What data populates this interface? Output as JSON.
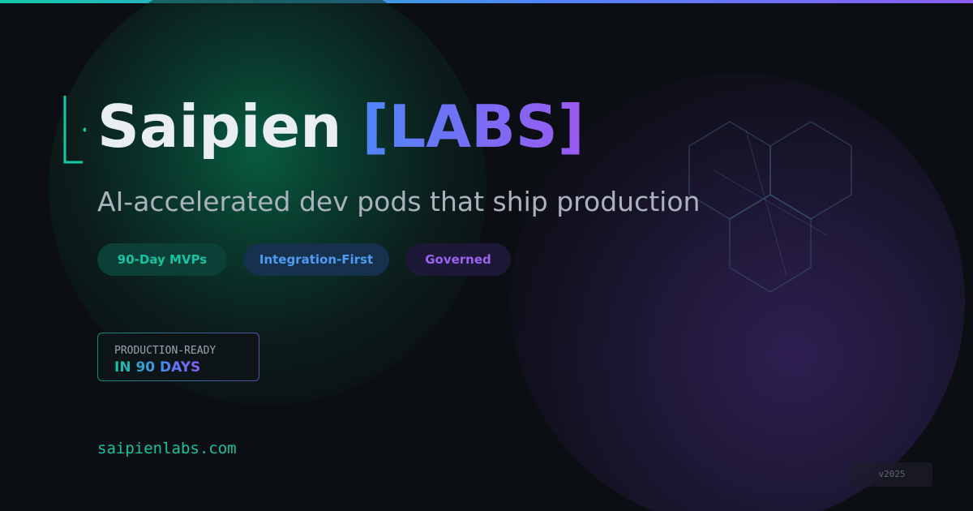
{
  "brand": {
    "name": "Saipien",
    "accent": "[LABS]",
    "logo_icon": "bracket-dot-icon"
  },
  "tagline": "AI-accelerated dev pods that ship production",
  "pills": [
    {
      "label": "90-Day MVPs",
      "color": "#17c3a0"
    },
    {
      "label": "Integration-First",
      "color": "#4f9bf2"
    },
    {
      "label": "Governed",
      "color": "#9a63f0"
    }
  ],
  "badge": {
    "label": "PRODUCTION-READY",
    "value": "IN 90 DAYS"
  },
  "website": "saipienlabs.com",
  "version": "v2025",
  "decoration": {
    "icon": "hexagon-cluster-icon"
  },
  "colors": {
    "background": "#0b0e13",
    "teal": "#14c8a8",
    "blue": "#4f86f7",
    "purple": "#8b5cf6",
    "title_text": "#e9eef2"
  }
}
